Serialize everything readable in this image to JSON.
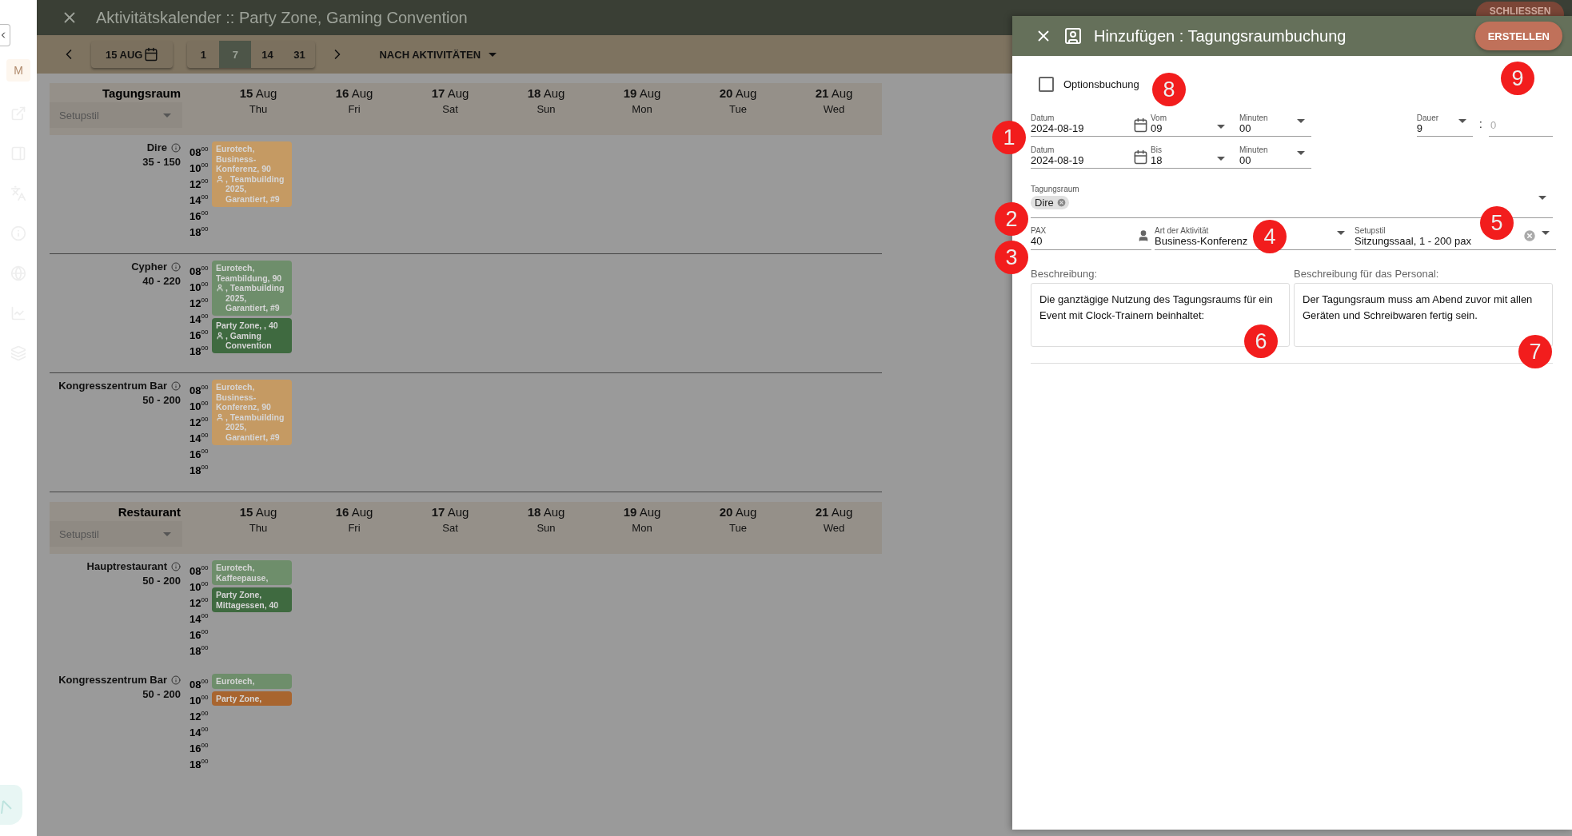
{
  "sidebar": {
    "avatar": "M"
  },
  "app_bar": {
    "title": "Aktivitätskalender :: Party Zone, Gaming Convention",
    "close_button": "SCHLIESSEN"
  },
  "toolbar": {
    "date_button": "15 AUG",
    "range_options": [
      {
        "label": "1",
        "selected": false
      },
      {
        "label": "7",
        "selected": true
      },
      {
        "label": "14",
        "selected": false
      },
      {
        "label": "31",
        "selected": false
      }
    ],
    "view_select": "NACH AKTIVITÄTEN"
  },
  "groups": [
    {
      "title": "Tagungsraum",
      "filter_placeholder": "Setupstil",
      "days": [
        {
          "day": "15",
          "month": "Aug",
          "weekday": "Thu"
        },
        {
          "day": "16",
          "month": "Aug",
          "weekday": "Fri"
        },
        {
          "day": "17",
          "month": "Aug",
          "weekday": "Sat"
        },
        {
          "day": "18",
          "month": "Aug",
          "weekday": "Sun"
        },
        {
          "day": "19",
          "month": "Aug",
          "weekday": "Mon"
        },
        {
          "day": "20",
          "month": "Aug",
          "weekday": "Tue"
        },
        {
          "day": "21",
          "month": "Aug",
          "weekday": "Wed"
        }
      ],
      "rooms": [
        {
          "name": "Dire",
          "capacity": "35 - 150",
          "divider": true,
          "times": [
            "08$^{00}$",
            "10$^{00}$",
            "12$^{00}$",
            "14$^{00}$",
            "16$^{00}$",
            "18$^{00}$"
          ],
          "events": [
            {
              "text": "Eurotech, Business-Konferenz, 90",
              "after_icon": ", Teambuilding 2025, Garantiert, #9",
              "color": "#c59a63"
            }
          ]
        },
        {
          "name": "Cypher",
          "capacity": "40 - 220",
          "divider": true,
          "times": [
            "08$^{00}$",
            "10$^{00}$",
            "12$^{00}$",
            "14$^{00}$",
            "16$^{00}$",
            "18$^{00}$"
          ],
          "events": [
            {
              "text": "Eurotech, Teambildung, 90",
              "after_icon": ", Teambuilding 2025, Garantiert, #9",
              "color": "#6e8e6b"
            },
            {
              "text": "Party Zone, , 40",
              "after_icon": ", Gaming Convention",
              "color": "#3f6a40"
            }
          ]
        },
        {
          "name": "Kongresszentrum Bar",
          "capacity": "50 - 200",
          "divider": true,
          "times": [
            "08$^{00}$",
            "10$^{00}$",
            "12$^{00}$",
            "14$^{00}$",
            "16$^{00}$",
            "18$^{00}$"
          ],
          "events": [
            {
              "text": "Eurotech, Business-Konferenz, 90",
              "after_icon": ", Teambuilding 2025, Garantiert, #9",
              "color": "#c59a63"
            }
          ]
        }
      ]
    },
    {
      "title": "Restaurant",
      "filter_placeholder": "Setupstil",
      "days": [
        {
          "day": "15",
          "month": "Aug",
          "weekday": "Thu"
        },
        {
          "day": "16",
          "month": "Aug",
          "weekday": "Fri"
        },
        {
          "day": "17",
          "month": "Aug",
          "weekday": "Sat"
        },
        {
          "day": "18",
          "month": "Aug",
          "weekday": "Sun"
        },
        {
          "day": "19",
          "month": "Aug",
          "weekday": "Mon"
        },
        {
          "day": "20",
          "month": "Aug",
          "weekday": "Tue"
        },
        {
          "day": "21",
          "month": "Aug",
          "weekday": "Wed"
        }
      ],
      "rooms": [
        {
          "name": "Hauptrestaurant",
          "capacity": "50 - 200",
          "divider": false,
          "times": [
            "08$^{00}$",
            "10$^{00}$",
            "12$^{00}$",
            "14$^{00}$",
            "16$^{00}$",
            "18$^{00}$"
          ],
          "events": [
            {
              "text": "Eurotech, Kaffeepause,",
              "color": "#6e8e6b"
            },
            {
              "text": "Party Zone, Mittagessen, 40",
              "color": "#3f6a40"
            }
          ]
        },
        {
          "name": "Kongresszentrum Bar",
          "capacity": "50 - 200",
          "divider": false,
          "times": [
            "08$^{00}$",
            "10$^{00}$",
            "12$^{00}$",
            "14$^{00}$",
            "16$^{00}$",
            "18$^{00}$"
          ],
          "events": [
            {
              "text": "Eurotech,",
              "color": "#6e8e6b"
            },
            {
              "text": "Party Zone,",
              "color": "#a8652f"
            }
          ]
        }
      ]
    }
  ],
  "dialog": {
    "title": "Hinzufügen : Tagungsraumbuchung",
    "submit_button": "ERSTELLEN",
    "option_booking": {
      "label": "Optionsbuchung",
      "checked": false
    },
    "time_rows": [
      {
        "date_label": "Datum",
        "date": "2024-08-19",
        "hour_label": "Vom",
        "hour": "09",
        "minute_label": "Minuten",
        "minute": "00"
      },
      {
        "date_label": "Datum",
        "date": "2024-08-19",
        "hour_label": "Bis",
        "hour": "18",
        "minute_label": "Minuten",
        "minute": "00"
      }
    ],
    "duration": {
      "label": "Dauer",
      "hours": "9",
      "separator": ":",
      "minutes_placeholder": "0"
    },
    "room": {
      "label": "Tagungsraum",
      "chips": [
        "Dire"
      ]
    },
    "pax": {
      "label": "PAX",
      "value": "40"
    },
    "activity_type": {
      "label": "Art der Aktivität",
      "value": "Business-Konferenz"
    },
    "setup_style": {
      "label": "Setupstil",
      "value": "Sitzungssaal, 1 - 200 pax"
    },
    "description": {
      "label": "Beschreibung:",
      "value": "Die ganztägige Nutzung des Tagungsraums für ein Event mit Clock-Trainern beinhaltet:"
    },
    "staff_description": {
      "label": "Beschreibung für das Personal:",
      "value": "Der Tagungsraum muss am Abend zuvor mit allen Geräten und Schreibwaren fertig sein."
    },
    "markers": [
      "1",
      "2",
      "3",
      "4",
      "5",
      "6",
      "7",
      "8",
      "9"
    ]
  }
}
